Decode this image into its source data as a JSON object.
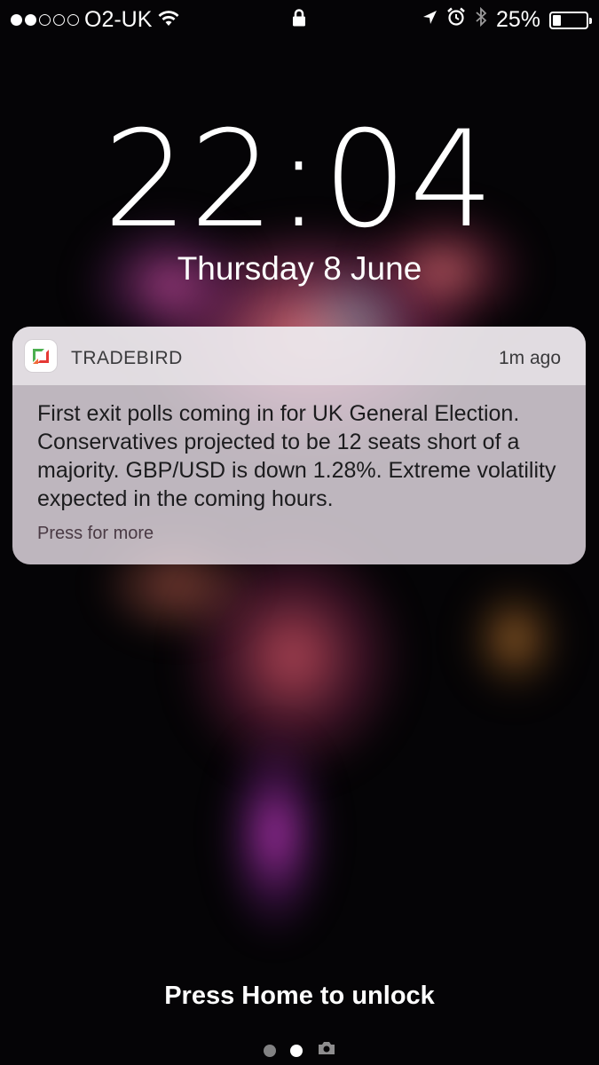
{
  "status_bar": {
    "signal_dots": [
      true,
      true,
      false,
      false,
      false
    ],
    "carrier": "O2-UK",
    "icons": [
      "wifi-icon",
      "lock-icon",
      "location-arrow-icon",
      "alarm-icon",
      "bluetooth-icon"
    ],
    "battery_percent": "25%",
    "battery_level": 0.25
  },
  "lock_screen": {
    "time": "22:04",
    "date": "Thursday 8 June"
  },
  "notification": {
    "app_name": "TRADEBIRD",
    "time_ago": "1m ago",
    "body": "First exit polls coming in for UK General Election. Conservatives projected to be 12 seats short of a majority. GBP/USD is down  1.28%. Extreme volatility expected in the coming hours.",
    "more": "Press for more"
  },
  "bottom": {
    "unlock_text": "Press Home to unlock",
    "pages": [
      "inactive",
      "active",
      "camera-icon"
    ]
  },
  "colors": {
    "background": "#050406",
    "notification_bg": "#e8dee6",
    "text_dark": "#1c1c1e",
    "logo_green": "#4caf50",
    "logo_red": "#e53935"
  }
}
